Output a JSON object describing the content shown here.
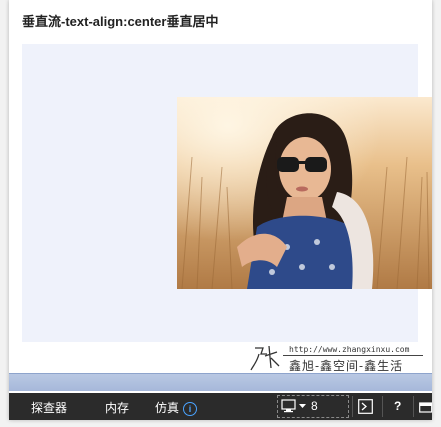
{
  "page": {
    "title": "垂直流-text-align:center垂直居中"
  },
  "watermark": {
    "signature": "张",
    "url": "http://www.zhangxinxu.com",
    "tagline": "鑫旭-鑫空间-鑫生活"
  },
  "devtools": {
    "tabs": [
      {
        "label": "探查器"
      },
      {
        "label": "内存"
      },
      {
        "label": "仿真"
      }
    ],
    "document_mode": "8",
    "help_label": "?",
    "info_icon": "i",
    "icons": [
      "monitor-icon",
      "dropdown-arrow-icon",
      "console-icon",
      "help-icon",
      "window-icon"
    ]
  },
  "colors": {
    "demo_background": "#eff2fb",
    "toolbar_background": "#2b2b2b",
    "accent": "#4aa3ff"
  }
}
